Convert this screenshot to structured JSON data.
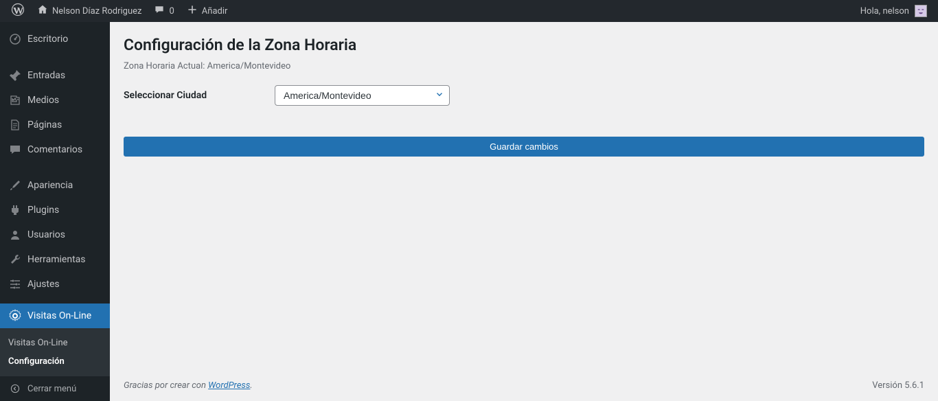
{
  "topbar": {
    "site_name": "Nelson Díaz Rodriguez",
    "comments_count": "0",
    "add_new": "Añadir",
    "greeting": "Hola, nelson"
  },
  "sidebar": {
    "items": [
      {
        "icon": "dashboard",
        "label": "Escritorio"
      },
      {
        "icon": "pin",
        "label": "Entradas"
      },
      {
        "icon": "media",
        "label": "Medios"
      },
      {
        "icon": "page",
        "label": "Páginas"
      },
      {
        "icon": "comment",
        "label": "Comentarios"
      },
      {
        "icon": "brush",
        "label": "Apariencia"
      },
      {
        "icon": "plug",
        "label": "Plugins"
      },
      {
        "icon": "user",
        "label": "Usuarios"
      },
      {
        "icon": "wrench",
        "label": "Herramientas"
      },
      {
        "icon": "sliders",
        "label": "Ajustes"
      },
      {
        "icon": "gear",
        "label": "Visitas On-Line"
      }
    ],
    "submenu": [
      "Visitas On-Line",
      "Configuración"
    ],
    "collapse": "Cerrar menú"
  },
  "main": {
    "title": "Configuración de la Zona Horaria",
    "current_tz_label": "Zona Horaria Actual: America/Montevideo",
    "field_label": "Seleccionar Ciudad",
    "field_value": "America/Montevideo",
    "save_button": "Guardar cambios"
  },
  "footer": {
    "thanks_prefix": "Gracias por crear con ",
    "wp_link": "WordPress",
    "thanks_suffix": ".",
    "version": "Versión 5.6.1"
  }
}
